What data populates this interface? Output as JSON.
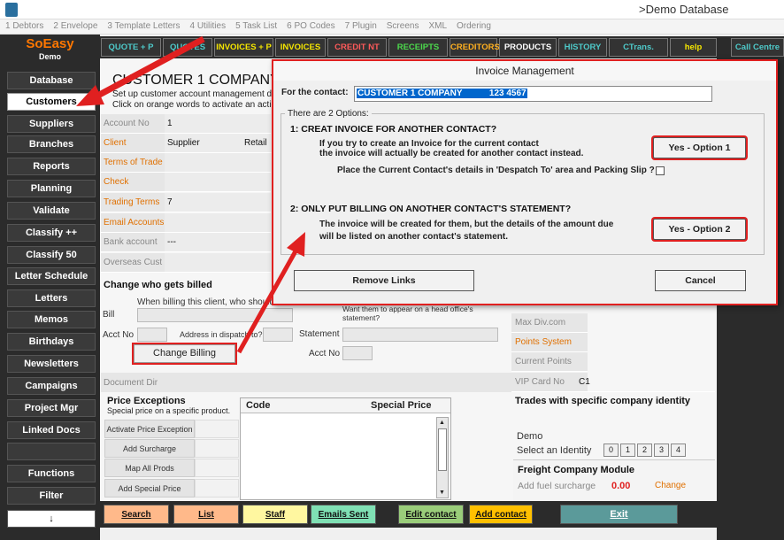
{
  "window": {
    "title": ">Demo Database"
  },
  "menubar": [
    "1 Debtors",
    "2 Envelope",
    "3 Template Letters",
    "4 Utilities",
    "5 Task List",
    "6 PO Codes",
    "7 Plugin",
    "Screens",
    "XML",
    "Ordering"
  ],
  "brand": {
    "name": "SoEasy",
    "sub": "Demo"
  },
  "sidebar": [
    "Database",
    "Customers",
    "Suppliers",
    "Branches",
    "Reports",
    "Planning",
    "Validate",
    "Classify ++",
    "Classify 50",
    "Letter Schedule",
    "Letters",
    "Memos",
    "Birthdays",
    "Newsletters",
    "Campaigns",
    "Project Mgr",
    "Linked Docs",
    "",
    "Functions",
    "Filter",
    "↓"
  ],
  "toolbar": [
    "QUOTE + P",
    "QUOTES",
    "INVOICES + P",
    "INVOICES",
    "CREDIT NT",
    "RECEIPTS",
    "CREDITORS",
    "PRODUCTS",
    "HISTORY",
    "CTrans.",
    "help",
    "Call Centre"
  ],
  "toolbar_colors": [
    "#4ec9c9",
    "#4ec9c9",
    "#f5e600",
    "#f5e600",
    "#ff5a5a",
    "#4cd94c",
    "#ffb020",
    "#ffffff",
    "#4ec9c9",
    "#4ec9c9",
    "#f5e600",
    "#4ec9c9"
  ],
  "main": {
    "title": "CUSTOMER 1 COMPANY",
    "desc1": "Set up customer account management d",
    "desc2": "Click on orange words to activate an actio",
    "fields": [
      {
        "label": "Account No",
        "value": "1",
        "orange": false
      },
      {
        "label": "Client",
        "value": "Supplier",
        "extra": "Retail",
        "orange": true
      },
      {
        "label": "Terms of Trade",
        "value": "",
        "orange": true
      },
      {
        "label": "Check",
        "value": "",
        "orange": true
      },
      {
        "label": "Trading Terms",
        "value": "7",
        "orange": true
      },
      {
        "label": "Email Accounts",
        "value": "",
        "orange": true
      },
      {
        "label": "Bank account",
        "value": "---",
        "orange": false
      },
      {
        "label": "Overseas Cust",
        "value": "",
        "orange": false
      }
    ],
    "billing": {
      "heading": "Change who gets billed",
      "hint": "When billing this client, who should is",
      "hint2": "Want them to appear on a head office's statement?",
      "bill_label": "Bill",
      "acct_label": "Acct No",
      "address_label": "Address in dispatch to?",
      "statement_label": "Statement",
      "acct_label2": "Acct No",
      "button": "Change Billing"
    },
    "document_dir": "Document Dir",
    "right_fields": [
      {
        "label": "Max Div.com",
        "value": "",
        "orange": false
      },
      {
        "label": "Points System",
        "value": "",
        "orange": true
      },
      {
        "label": "Current Points",
        "value": "",
        "orange": false
      },
      {
        "label": "VIP Card No",
        "value": "C1",
        "orange": false
      }
    ],
    "trades_heading": "Trades with specific company identity",
    "identity_value": "Demo",
    "identity_label": "Select an Identity",
    "identity_options": [
      "0",
      "1",
      "2",
      "3",
      "4"
    ],
    "freight_heading": "Freight Company Module",
    "freight_label": "Add fuel surcharge",
    "freight_value": "0.00",
    "freight_change": "Change",
    "price": {
      "heading": "Price Exceptions",
      "sub": "Special price on a specific product.",
      "buttons": [
        "Activate Price Exception",
        "Add Surcharge",
        "Map All Prods",
        "Add Special Price"
      ],
      "col_code": "Code",
      "col_special": "Special Price"
    }
  },
  "bottom": [
    {
      "label": "Search",
      "color": "#ffb98a"
    },
    {
      "label": "List",
      "color": "#ffb98a"
    },
    {
      "label": "Staff",
      "color": "#fff7a0"
    },
    {
      "label": "Emails Sent",
      "color": "#7fe0b4"
    },
    {
      "label": "Edit contact",
      "color": "#9acd7a"
    },
    {
      "label": "Add contact",
      "color": "#ffc000"
    },
    {
      "label": "Exit",
      "color": "#5b9a9a"
    }
  ],
  "dialog": {
    "title": "Invoice Management",
    "contact_label": "For the contact:",
    "contact_value": "CUSTOMER 1 COMPANY           123 4567",
    "options_title": "There are 2 Options:",
    "opt1_heading": "1: CREAT INVOICE FOR ANOTHER CONTACT?",
    "opt1_line1": "If you try to create an Invoice for the current contact",
    "opt1_line2": "the invoice will actually be created for another contact instead.",
    "opt1_check": "Place the Current Contact's details in 'Despatch To' area and Packing Slip ?",
    "opt1_button": "Yes - Option 1",
    "opt2_heading": "2: ONLY PUT BILLING ON ANOTHER CONTACT'S STATEMENT?",
    "opt2_line1": "The invoice will be created for them, but the details of the amount due",
    "opt2_line2": "will be listed on another contact's statement.",
    "opt2_button": "Yes - Option 2",
    "remove_links": "Remove Links",
    "cancel": "Cancel"
  }
}
